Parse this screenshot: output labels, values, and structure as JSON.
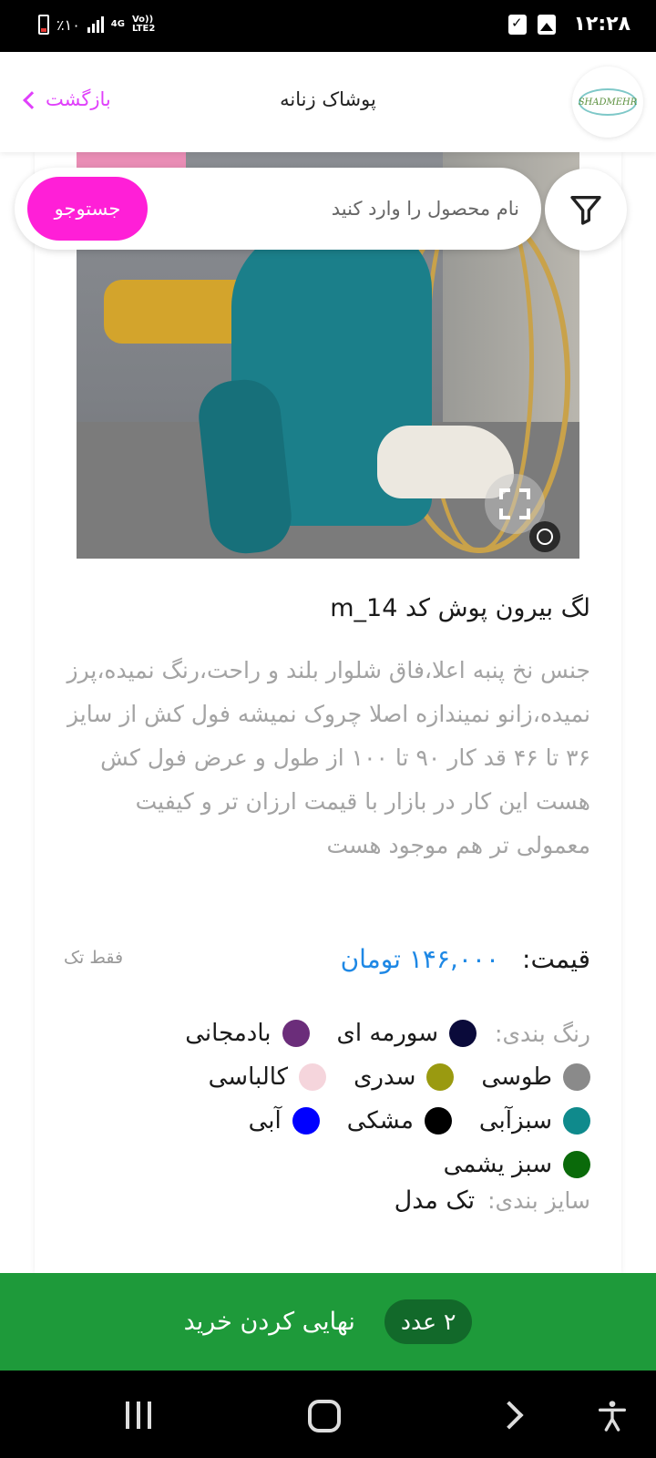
{
  "status_bar": {
    "time": "۱۲:۲۸",
    "battery_text": "٪۱۰",
    "network_4g": "4G",
    "network_volte": "Vo))",
    "network_lte": "LTE2"
  },
  "header": {
    "title": "پوشاک زنانه",
    "back_label": "بازگشت",
    "logo_text": "SHADMEHR"
  },
  "search": {
    "placeholder": "نام محصول را وارد کنید",
    "button_label": "جستوجو"
  },
  "product": {
    "title": "لگ بیرون پوش کد m_14",
    "description": "جنس نخ پنبه اعلا،فاق شلوار بلند و راحت،رنگ نمیده،پرز نمیده،زانو نمیندازه اصلا چروک نمیشه فول کش از سایز ۳۶ تا ۴۶ قد کار ۹۰ تا ۱۰۰ از طول و عرض فول کش هست این کار در بازار با قیمت ارزان تر و کیفیت معمولی تر هم موجود هست",
    "price_label": "قیمت:",
    "price_value": "۱۴۶,۰۰۰ تومان",
    "single_only": "فقط تک",
    "colors_label": "رنگ بندی:",
    "colors": [
      {
        "name": "سورمه ای",
        "hex": "#0a0a3a"
      },
      {
        "name": "بادمجانی",
        "hex": "#6b2d7a"
      },
      {
        "name": "طوسی",
        "hex": "#8a8a8a"
      },
      {
        "name": "سدری",
        "hex": "#9a9a10"
      },
      {
        "name": "کالباسی",
        "hex": "#f5d5dc"
      },
      {
        "name": "سبزآبی",
        "hex": "#0f8a8c"
      },
      {
        "name": "مشکی",
        "hex": "#000000"
      },
      {
        "name": "آبی",
        "hex": "#0000ff"
      },
      {
        "name": "سبز یشمی",
        "hex": "#0a6a0a"
      }
    ],
    "size_label": "سایز بندی:",
    "size_value": "تک مدل"
  },
  "checkout": {
    "label": "نهایی کردن خرید",
    "count": "۲ عدد"
  },
  "colors_theme": {
    "accent": "#ff1fd7",
    "back": "#e040fb",
    "price": "#1e88e5",
    "checkout": "#1e9a3a"
  }
}
